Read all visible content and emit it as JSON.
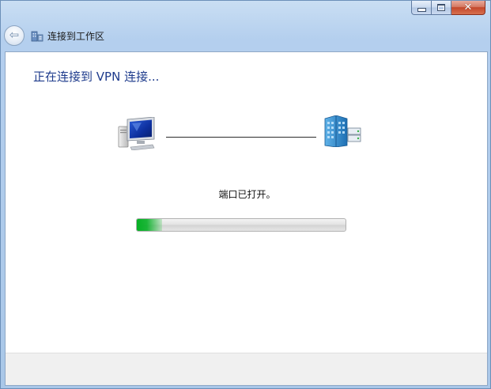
{
  "window": {
    "title": "连接到工作区",
    "controls": {
      "minimize_icon": "minimize-icon",
      "maximize_icon": "maximize-icon",
      "close_icon": "close-icon",
      "close_glyph": "✕"
    }
  },
  "nav": {
    "back_icon": "back-arrow-icon",
    "back_glyph": "⇦",
    "title_icon": "workplace-network-icon"
  },
  "main": {
    "heading": "正在连接到 VPN 连接...",
    "client_icon": "computer-icon",
    "server_icon": "server-icon",
    "status": "端口已打开。",
    "progress": 0.12
  },
  "colors": {
    "heading": "#1e3b8c",
    "progress_fill": "#06b025",
    "close_button": "#c4472b"
  }
}
